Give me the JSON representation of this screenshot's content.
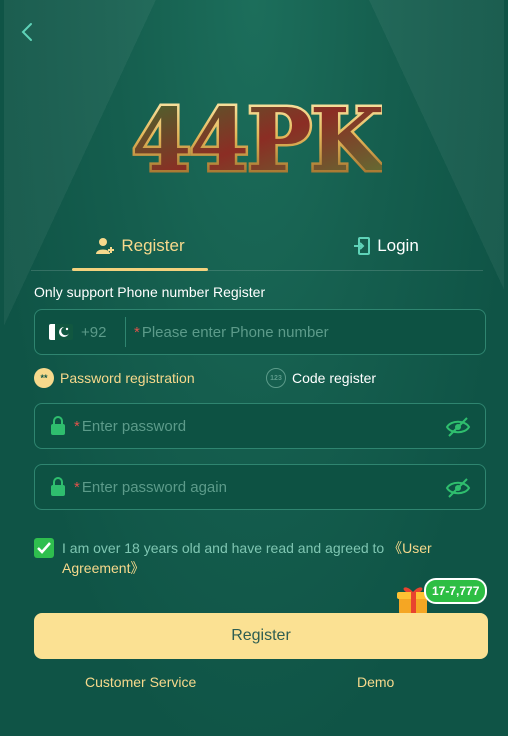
{
  "header": {
    "back_icon": "chevron-left-icon"
  },
  "logo": {
    "text": "44PK"
  },
  "tabs": [
    {
      "label": "Register",
      "icon": "user-add-icon",
      "active": true
    },
    {
      "label": "Login",
      "icon": "login-door-icon",
      "active": false
    }
  ],
  "hint": "Only support Phone number Register",
  "phone": {
    "country_code": "+92",
    "required_mark": "*",
    "placeholder": "Please enter Phone number",
    "flag": "pakistan-flag"
  },
  "modes": [
    {
      "label": "Password registration",
      "icon_text": "**",
      "active": true
    },
    {
      "label": "Code register",
      "icon_text": "123",
      "active": false
    }
  ],
  "password": {
    "required_mark": "*",
    "placeholder": "Enter password"
  },
  "password_again": {
    "required_mark": "*",
    "placeholder": "Enter password again"
  },
  "agreement": {
    "checked": true,
    "text": "I am over 18 years old and have read and agreed to ",
    "link": "《User Agreement》"
  },
  "bonus": {
    "badge": "17-7,777"
  },
  "register_button": "Register",
  "footer": {
    "customer_service": "Customer Service",
    "demo": "Demo"
  },
  "colors": {
    "background": "#0f5446",
    "accent": "#f7d98c",
    "button": "#fbe193",
    "check": "#2fbe4e",
    "badge": "#2dbe44"
  }
}
